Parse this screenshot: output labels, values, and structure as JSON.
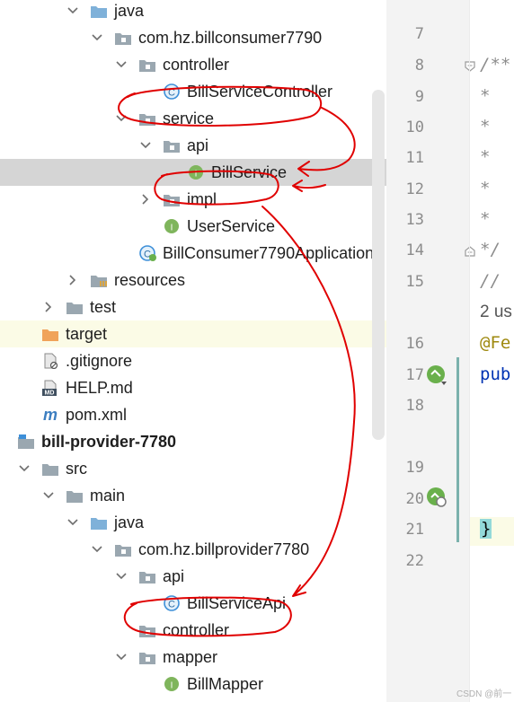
{
  "project_tree": {
    "rows": [
      {
        "label": "java",
        "icon": "source-folder-icon",
        "expanded": true
      },
      {
        "label": "com.hz.billconsumer7790",
        "icon": "package-icon",
        "expanded": true
      },
      {
        "label": "controller",
        "icon": "package-icon",
        "expanded": true
      },
      {
        "label": "BillServiceController",
        "icon": "class-icon",
        "badge": "C"
      },
      {
        "label": "service",
        "icon": "package-icon",
        "expanded": true
      },
      {
        "label": "api",
        "icon": "package-icon",
        "expanded": true
      },
      {
        "label": "BillService",
        "icon": "interface-icon",
        "badge": "I",
        "selected": true
      },
      {
        "label": "impl",
        "icon": "package-icon",
        "expanded": false
      },
      {
        "label": "UserService",
        "icon": "interface-icon",
        "badge": "I"
      },
      {
        "label": "BillConsumer7790Application",
        "icon": "spring-boot-class-icon",
        "badge": "C"
      },
      {
        "label": "resources",
        "icon": "resources-folder-icon",
        "expanded": false
      },
      {
        "label": "test",
        "icon": "folder-icon",
        "expanded": false
      },
      {
        "label": "target",
        "icon": "excluded-folder-icon",
        "expanded": false
      },
      {
        "label": ".gitignore",
        "icon": "ignored-file-icon"
      },
      {
        "label": "HELP.md",
        "icon": "markdown-file-icon",
        "badge": "MD"
      },
      {
        "label": "pom.xml",
        "icon": "maven-file-icon",
        "badge": "m"
      },
      {
        "label": "bill-provider-7780",
        "icon": "module-icon"
      },
      {
        "label": "src",
        "icon": "folder-icon",
        "expanded": true
      },
      {
        "label": "main",
        "icon": "folder-icon",
        "expanded": true
      },
      {
        "label": "java",
        "icon": "source-folder-icon",
        "expanded": true
      },
      {
        "label": "com.hz.billprovider7780",
        "icon": "package-icon",
        "expanded": true
      },
      {
        "label": "api",
        "icon": "package-icon",
        "expanded": true
      },
      {
        "label": "BillServiceApi",
        "icon": "class-icon",
        "badge": "C"
      },
      {
        "label": "controller",
        "icon": "package-icon"
      },
      {
        "label": "mapper",
        "icon": "package-icon",
        "expanded": true
      },
      {
        "label": "BillMapper",
        "icon": "interface-icon",
        "badge": "I"
      }
    ]
  },
  "editor": {
    "line_numbers": [
      "7",
      "8",
      "9",
      "10",
      "11",
      "12",
      "13",
      "14",
      "15",
      "16",
      "17",
      "18",
      "19",
      "20",
      "21",
      "22"
    ],
    "code": {
      "l8": "/**",
      "l9": " *",
      "l10": " *",
      "l11": " *",
      "l12": " *",
      "l13": " *",
      "l14": " */",
      "l15": "//",
      "usages": "2 us",
      "l16": "@Fe",
      "l17": "pub",
      "l21": "}"
    }
  },
  "watermark": "CSDN @前一",
  "colors": {
    "selection": "#d5d5d5",
    "folder_blue": "#7fb1d9",
    "package_grey": "#9aa7b0",
    "excluded_orange": "#f0a35a",
    "class_blue": "#3d8fd8",
    "interface_green": "#7fb55c",
    "annotation": "#9e880d",
    "keyword": "#0033b3",
    "annotation_ink": "#e00000"
  }
}
